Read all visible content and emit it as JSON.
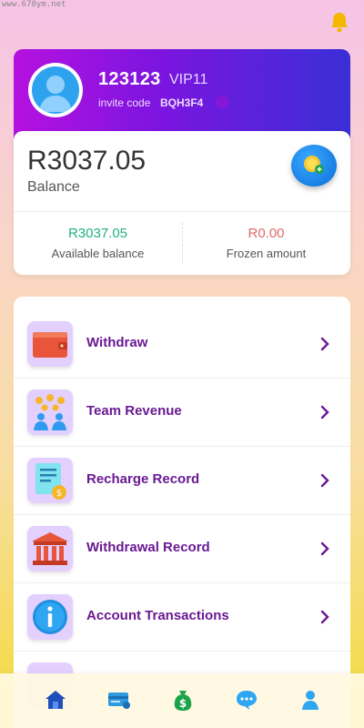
{
  "watermark": "www.678ym.net",
  "header": {
    "notification_icon": "bell-icon",
    "bell_color": "#f5b800"
  },
  "profile": {
    "username": "123123",
    "vip_level": "VIP11",
    "invite_label": "invite code",
    "invite_code": "BQH3F4",
    "avatar_icon": "user-avatar-icon"
  },
  "balance": {
    "amount": "R3037.05",
    "label": "Balance",
    "recharge_icon": "coin-add-icon",
    "available_amount": "R3037.05",
    "available_label": "Available balance",
    "frozen_amount": "R0.00",
    "frozen_label": "Frozen amount"
  },
  "menu": [
    {
      "label": "Withdraw",
      "icon": "wallet-icon"
    },
    {
      "label": "Team Revenue",
      "icon": "team-coins-icon"
    },
    {
      "label": "Recharge Record",
      "icon": "receipt-icon"
    },
    {
      "label": "Withdrawal Record",
      "icon": "bank-icon"
    },
    {
      "label": "Account Transactions",
      "icon": "info-icon"
    }
  ],
  "bottom_nav": [
    {
      "name": "home",
      "icon": "home-icon"
    },
    {
      "name": "tasks",
      "icon": "card-icon"
    },
    {
      "name": "earn",
      "icon": "money-bag-icon"
    },
    {
      "name": "service",
      "icon": "chat-icon"
    },
    {
      "name": "mine",
      "icon": "person-icon"
    }
  ],
  "colors": {
    "menu_text": "#6a1a94",
    "available": "#20b27a",
    "frozen": "#e06a6a",
    "profile_gradient_start": "#b511e0",
    "profile_gradient_end": "#3a2fd6"
  }
}
